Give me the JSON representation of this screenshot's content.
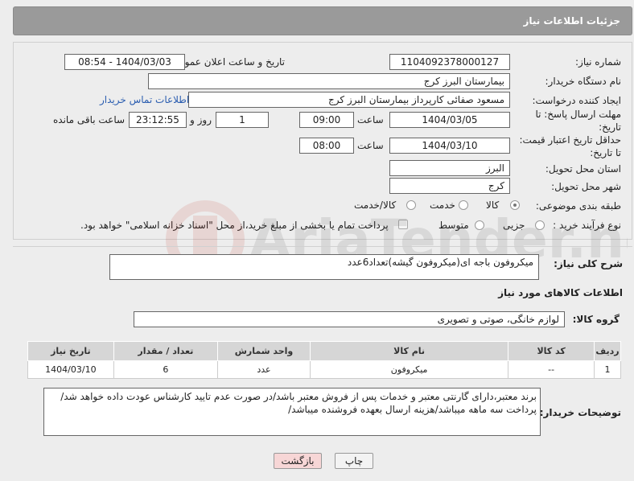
{
  "header": {
    "title": "جزئیات اطلاعات نیاز"
  },
  "fields": {
    "need_number_label": "شماره نیاز:",
    "need_number": "1104092378000127",
    "announce_label": "تاریخ و ساعت اعلان عمومی:",
    "announce_value": "1404/03/03 - 08:54",
    "buyer_label": "نام دستگاه خریدار:",
    "buyer": "بیمارستان البرز کرج",
    "creator_label": "ایجاد کننده درخواست:",
    "creator": "مسعود صفائی کارپرداز بیمارستان البرز کرج",
    "contact_link": "اطلاعات تماس خریدار",
    "deadline_label": "مهلت ارسال پاسخ: تا تاریخ:",
    "deadline_date": "1404/03/05",
    "time_label": "ساعت",
    "deadline_time": "09:00",
    "deadline_days": "1",
    "day_label": "روز و",
    "remaining": "23:12:55",
    "remaining_label": "ساعت باقی مانده",
    "price_label": "حداقل تاریخ اعتبار قیمت: تا تاریخ:",
    "price_date": "1404/03/10",
    "price_time": "08:00",
    "province_label": "استان محل تحویل:",
    "province": "البرز",
    "city_label": "شهر محل تحویل:",
    "city": "کرج",
    "category_label": "طبقه بندی موضوعی:",
    "category_options": [
      "کالا",
      "خدمت",
      "کالا/خدمت"
    ],
    "process_label": "نوع فرآیند خرید :",
    "process_options": [
      "جزیی",
      "متوسط"
    ],
    "payment_note": "پرداخت تمام یا بخشی از مبلغ خرید،از محل \"اسناد خزانه اسلامی\" خواهد بود."
  },
  "description": {
    "label": "شرح کلی نیاز:",
    "value": "میکروفون باجه ای(میکروفون گیشه)تعداد6عدد"
  },
  "goods": {
    "section_title": "اطلاعات کالاهای مورد نیاز",
    "group_label": "گروه کالا:",
    "group_value": "لوازم خانگی، صوتی و تصویری"
  },
  "table": {
    "headers": [
      "ردیف",
      "کد کالا",
      "نام کالا",
      "واحد شمارش",
      "تعداد / مقدار",
      "تاریخ نیاز"
    ],
    "rows": [
      [
        "1",
        "--",
        "میکروفون",
        "عدد",
        "6",
        "1404/03/10"
      ]
    ]
  },
  "buyer_notes": {
    "label": "توضیحات خریدار:",
    "value": "برند معتبر،دارای گارنتی معتبر و خدمات پس از فروش معتبر باشد/در صورت عدم تایید کارشناس عودت داده خواهد شد/پرداخت سه ماهه میباشد/هزینه ارسال بعهده فروشنده میباشد/"
  },
  "buttons": {
    "print": "چاپ",
    "back": "بازگشت"
  },
  "watermark": "AriaTender.neT",
  "colors": {
    "header_bg": "#9a9a9a",
    "link": "#2a5db0",
    "back_btn_bg": "#f7d6d6"
  }
}
